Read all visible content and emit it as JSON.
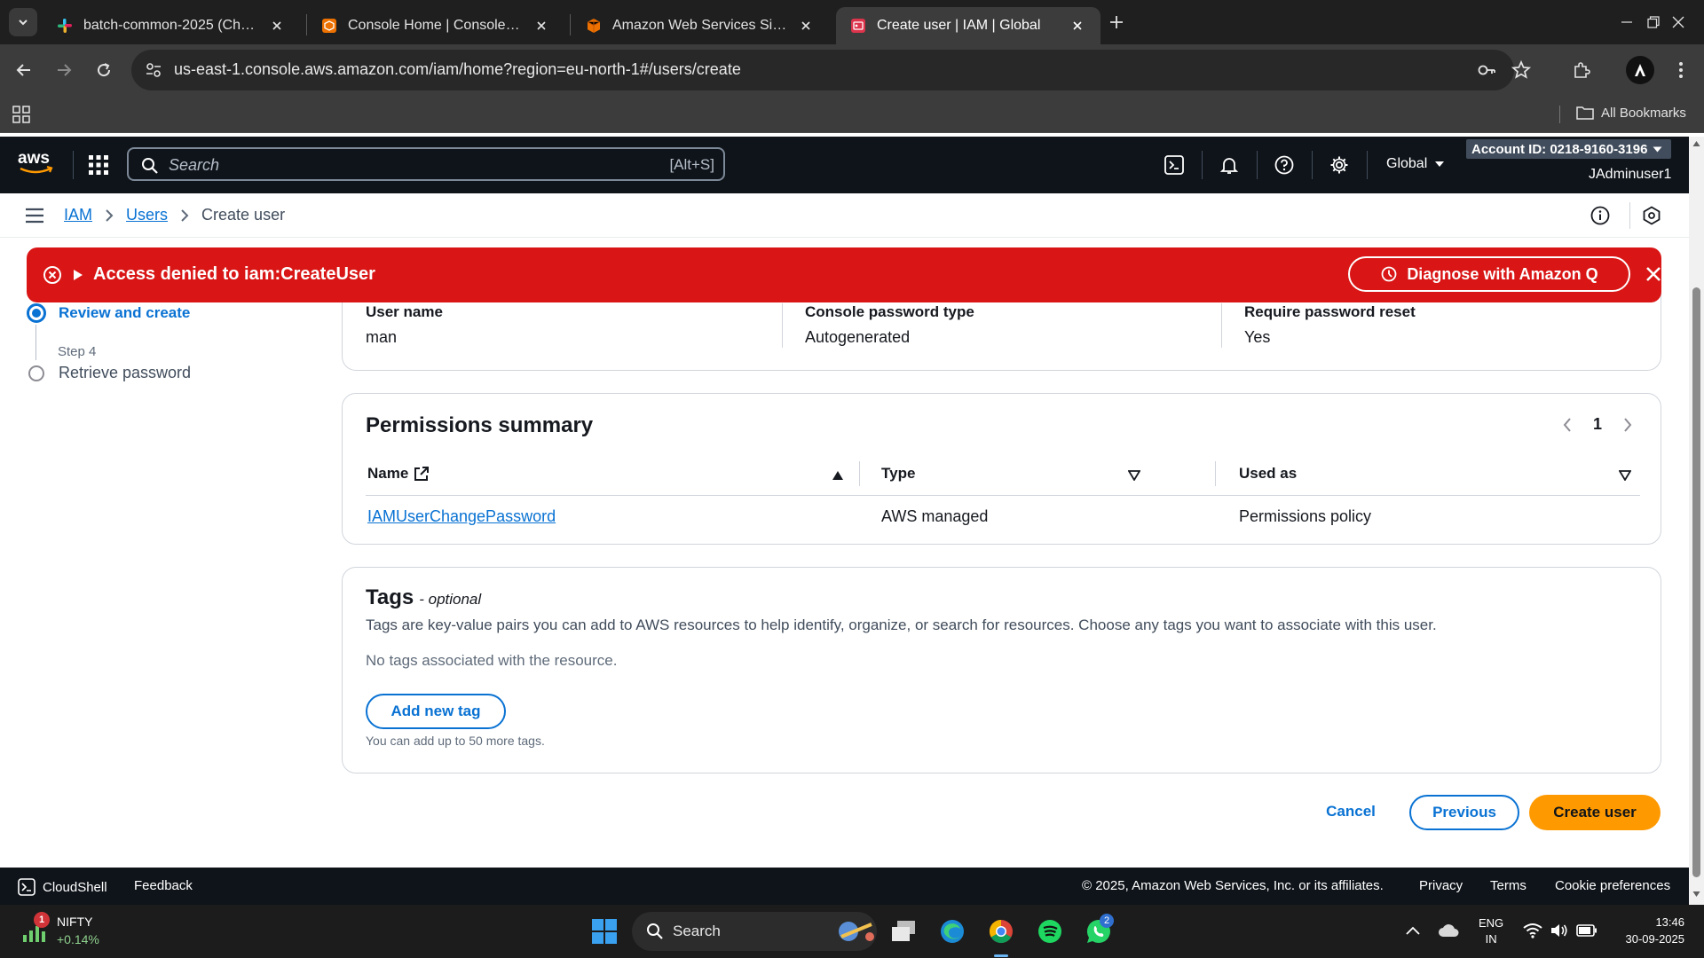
{
  "browser": {
    "tabs": [
      {
        "title": "batch-common-2025 (Channel)",
        "active": false
      },
      {
        "title": "Console Home | Console Home",
        "active": false
      },
      {
        "title": "Amazon Web Services Sign-In",
        "active": false
      },
      {
        "title": "Create user | IAM | Global",
        "active": true
      }
    ],
    "url": "us-east-1.console.aws.amazon.com/iam/home?region=eu-north-1#/users/create",
    "bookmarks_label": "All Bookmarks"
  },
  "aws_header": {
    "search_placeholder": "Search",
    "search_shortcut": "[Alt+S]",
    "region": "Global",
    "account_id": "Account ID: 0218-9160-3196",
    "user": "JAdminuser1"
  },
  "breadcrumb": {
    "items": [
      "IAM",
      "Users"
    ],
    "current": "Create user"
  },
  "flash": {
    "message": "Access denied to iam:CreateUser",
    "action_label": "Diagnose with Amazon Q",
    "color": "#d91515"
  },
  "steps": {
    "active_label": "Review and create",
    "step4_number": "Step 4",
    "step4_label": "Retrieve password"
  },
  "user_details": {
    "user_name_label": "User name",
    "user_name_value": "man",
    "password_type_label": "Console password type",
    "password_type_value": "Autogenerated",
    "reset_label": "Require password reset",
    "reset_value": "Yes"
  },
  "permissions": {
    "title": "Permissions summary",
    "page": "1",
    "columns": [
      "Name",
      "Type",
      "Used as"
    ],
    "rows": [
      {
        "name": "IAMUserChangePassword",
        "type": "AWS managed",
        "used_as": "Permissions policy"
      }
    ]
  },
  "tags": {
    "title": "Tags",
    "optional": "- optional",
    "description": "Tags are key-value pairs you can add to AWS resources to help identify, organize, or search for resources. Choose any tags you want to associate with this user.",
    "empty": "No tags associated with the resource.",
    "add_button": "Add new tag",
    "hint": "You can add up to 50 more tags."
  },
  "actions": {
    "cancel": "Cancel",
    "previous": "Previous",
    "create": "Create user",
    "primary_color": "#ff9900"
  },
  "console_footer": {
    "cloudshell": "CloudShell",
    "feedback": "Feedback",
    "copyright": "© 2025, Amazon Web Services, Inc. or its affiliates.",
    "privacy": "Privacy",
    "terms": "Terms",
    "cookies": "Cookie preferences"
  },
  "taskbar": {
    "nifty_name": "NIFTY",
    "nifty_change": "+0.14%",
    "nifty_badge": "1",
    "search_label": "Search",
    "whatsapp_badge": "2",
    "lang_top": "ENG",
    "lang_bottom": "IN",
    "time": "13:46",
    "date": "30-09-2025"
  }
}
